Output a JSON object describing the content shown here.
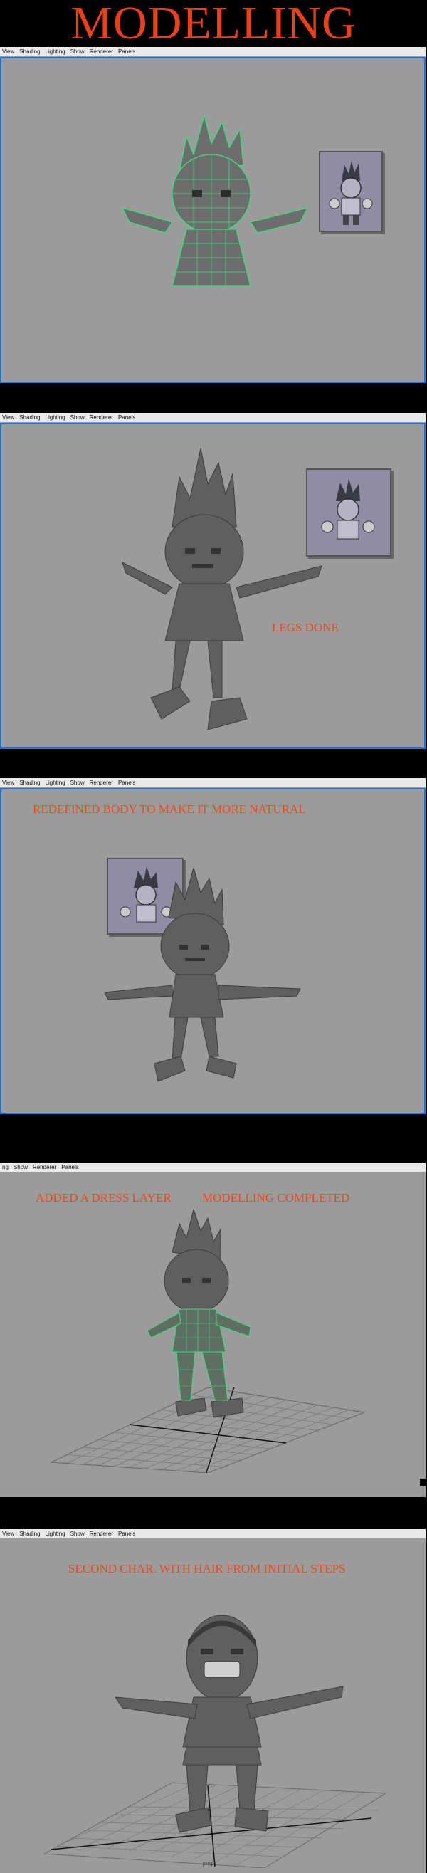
{
  "title": "MODELLING",
  "menu": [
    "View",
    "Shading",
    "Lighting",
    "Show",
    "Renderer",
    "Panels"
  ],
  "menu_partial": [
    "ng",
    "Show",
    "Renderer",
    "Panels"
  ],
  "notes": {
    "legs": "LEGS DONE",
    "refined": "REDEFINED BODY TO MAKE IT MORE NATURAL",
    "dress_a": "ADDED A DRESS LAYER",
    "dress_b": "MODELLING COMPLETED",
    "second": "SECOND CHAR. WITH HAIR FROM INITIAL STEPS"
  },
  "viewport_label": "persp",
  "colors": {
    "title": "#e8401c",
    "wire": "#39e07a",
    "viewport": "#9b9b9b",
    "selection": "#2b6fd4"
  }
}
